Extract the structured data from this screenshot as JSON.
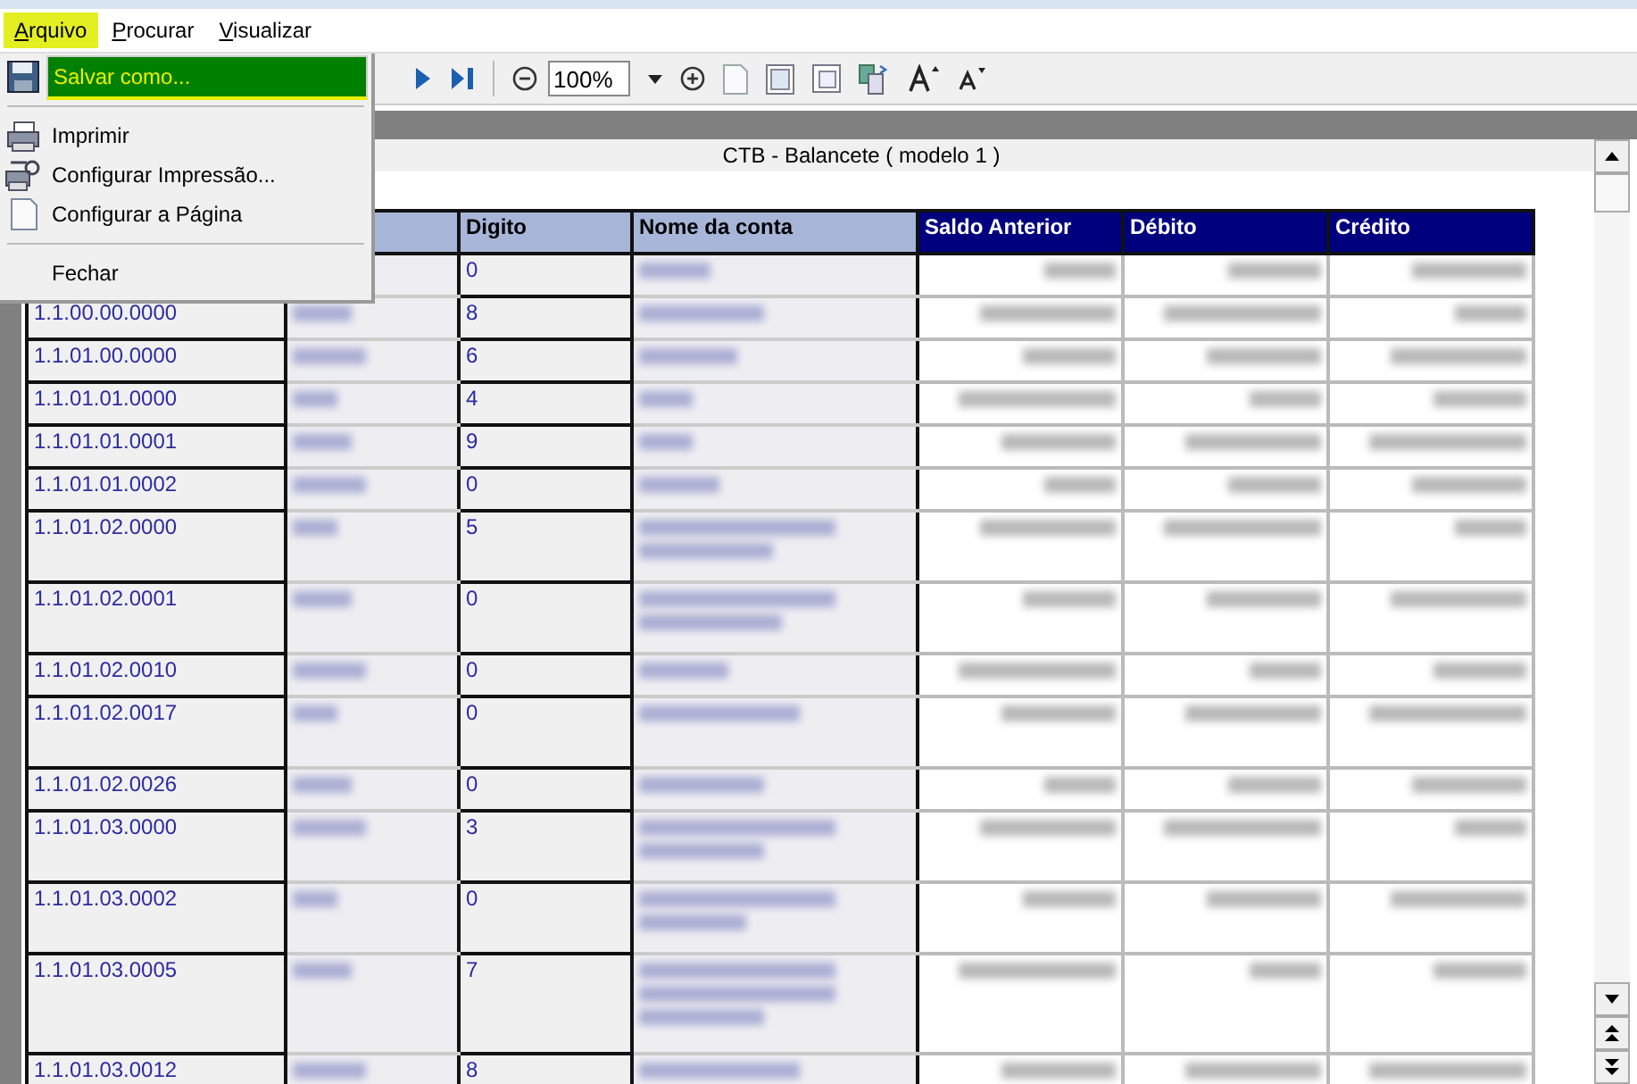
{
  "menu_bar": [
    {
      "label": "Arquivo",
      "selected": true
    },
    {
      "label": "Procurar",
      "selected": false
    },
    {
      "label": "Visualizar",
      "selected": false
    }
  ],
  "menu": {
    "items": [
      {
        "kind": "item",
        "label": "Salvar como...",
        "selected": true
      },
      {
        "kind": "separator"
      },
      {
        "kind": "item",
        "label": "Imprimir",
        "selected": false
      },
      {
        "kind": "item",
        "label": "Configurar Impressão...",
        "selected": false
      },
      {
        "kind": "item",
        "label": "Configurar a Página",
        "selected": false
      },
      {
        "kind": "separator"
      },
      {
        "kind": "item",
        "label": "Fechar",
        "selected": false
      }
    ]
  },
  "toolbar": {
    "zoom": "100%"
  },
  "report": {
    "title": "CTB - Balancete  ( modelo 1 )",
    "columns": [
      {
        "label": "Digito",
        "kind": "light"
      },
      {
        "label": "Nome da conta",
        "kind": "light"
      },
      {
        "label": "Saldo Anterior",
        "kind": "dark"
      },
      {
        "label": "Débito",
        "kind": "dark"
      },
      {
        "label": "Crédito",
        "kind": "dark"
      }
    ],
    "rows": [
      {
        "digit": "0"
      },
      {
        "code": "1.1.00.00.0000",
        "digit": "8"
      },
      {
        "code": "1.1.01.00.0000",
        "digit": "6"
      },
      {
        "code": "1.1.01.01.0000",
        "digit": "4"
      },
      {
        "code": "1.1.01.01.0001",
        "digit": "9"
      },
      {
        "code": "1.1.01.01.0002",
        "digit": "0"
      },
      {
        "code": "1.1.01.02.0000",
        "digit": "5"
      },
      {
        "code": "1.1.01.02.0001",
        "digit": "0"
      },
      {
        "code": "1.1.01.02.0010",
        "digit": "0"
      },
      {
        "code": "1.1.01.02.0017",
        "digit": "0"
      },
      {
        "code": "1.1.01.02.0026",
        "digit": "0"
      },
      {
        "code": "1.1.01.03.0000",
        "digit": "3"
      },
      {
        "code": "1.1.01.03.0002",
        "digit": "0"
      },
      {
        "code": "1.1.01.03.0005",
        "digit": "7"
      },
      {
        "code": "1.1.01.03.0012",
        "digit": "8"
      }
    ]
  }
}
